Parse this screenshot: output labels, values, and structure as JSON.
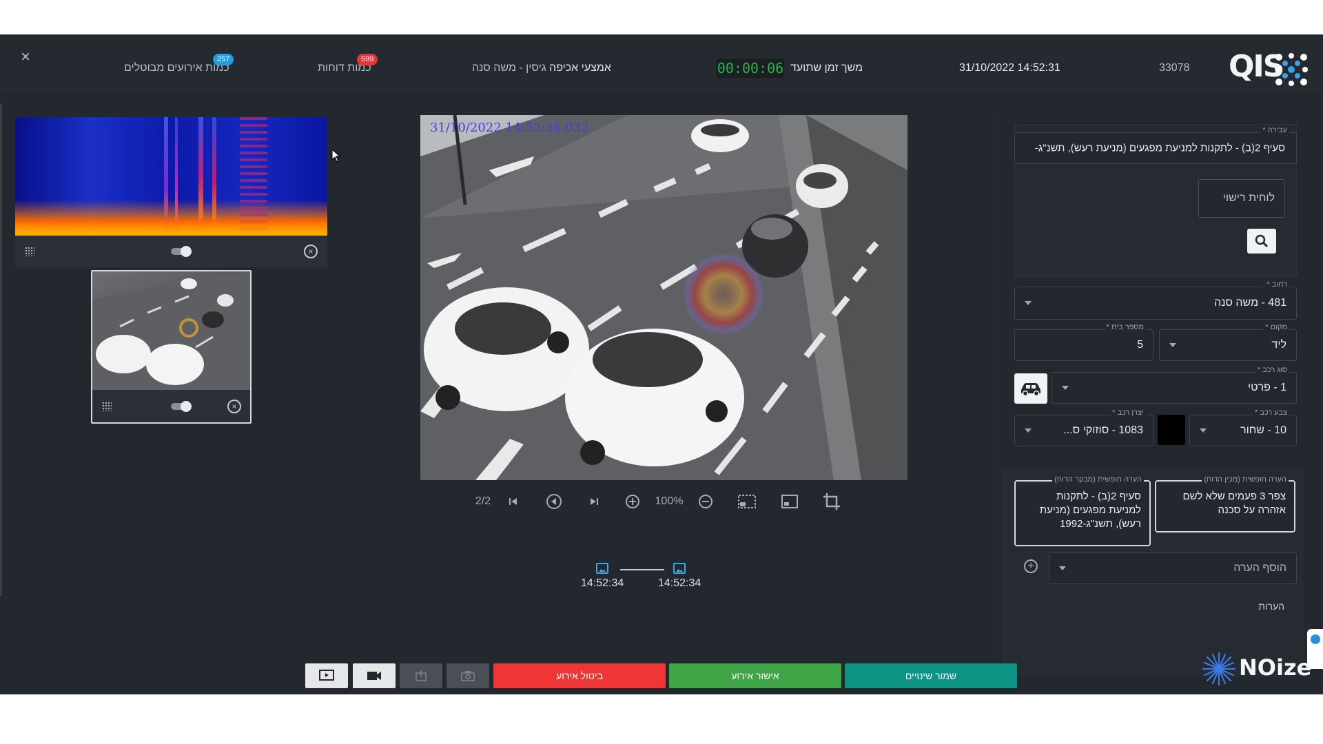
{
  "header": {
    "close_label": "×",
    "cancelled_events_label": "כמות אירועים מבוטלים",
    "cancelled_events_count": "257",
    "reports_label": "כמות דוחות",
    "reports_count": "599",
    "enforcement_label": "אמצעי אכיפה",
    "enforcement_value": "גיסין - משה סנה",
    "shared_time_label": "משך זמן שתועד",
    "timer_value": "00:00:06",
    "datetime": "31/10/2022 14:52:31",
    "event_id": "33078",
    "logo_text": "QIS"
  },
  "spectrogram": {
    "colors": {
      "low": "#0a16a0",
      "high": "#ffcc00"
    }
  },
  "viewer": {
    "timestamp": "31/10/2022 14:52:34.032",
    "page_indicator": "2/2",
    "zoom_level": "100%",
    "timeline": {
      "start_time": "14:52:34",
      "end_time": "14:52:34"
    }
  },
  "form": {
    "offense_label": "עבירה *",
    "offense_value": "סעיף 2(ב) - לתקנות למניעת מפגעים (מניעת רעש), תשנ\"ג-",
    "license_plate_placeholder": "לוחית רישוי",
    "street_label": "רחוב *",
    "street_value": "481 - משה סנה",
    "place_label": "מקום *",
    "place_value": "ליד",
    "house_number_label": "מספר בית *",
    "house_number_value": "5",
    "vehicle_type_label": "סוג רכב *",
    "vehicle_type_value": "1 - פרטי",
    "vehicle_color_label": "צבע רכב *",
    "vehicle_color_value": "10 - שחור",
    "vehicle_color_swatch": "#000000",
    "manufacturer_label": "יצרן רכב *",
    "manufacturer_value": "1083 - סוזוקי ס...",
    "note_preparer_label": "הערה חופשית (מכין הדוח)",
    "note_preparer_value": "צפר 3 פעמים שלא לשם אזהרה על סכנה",
    "note_reviewer_label": "הערה חופשית (מבקר הדוח)",
    "note_reviewer_value": "סעיף 2(ב) - לתקנות למניעת מפגעים (מניעת רעש), תשנ\"ג-1992",
    "add_note_placeholder": "הוסף הערה",
    "notes_label": "הערות"
  },
  "actions": {
    "cancel_event": "ביטול אירוע",
    "approve_event": "אישור אירוע",
    "save_changes": "שמור שינויים",
    "colors": {
      "cancel": "#ef3535",
      "approve": "#3fa546",
      "save": "#0c9384"
    }
  },
  "branding": {
    "noize_text": "NOize"
  }
}
